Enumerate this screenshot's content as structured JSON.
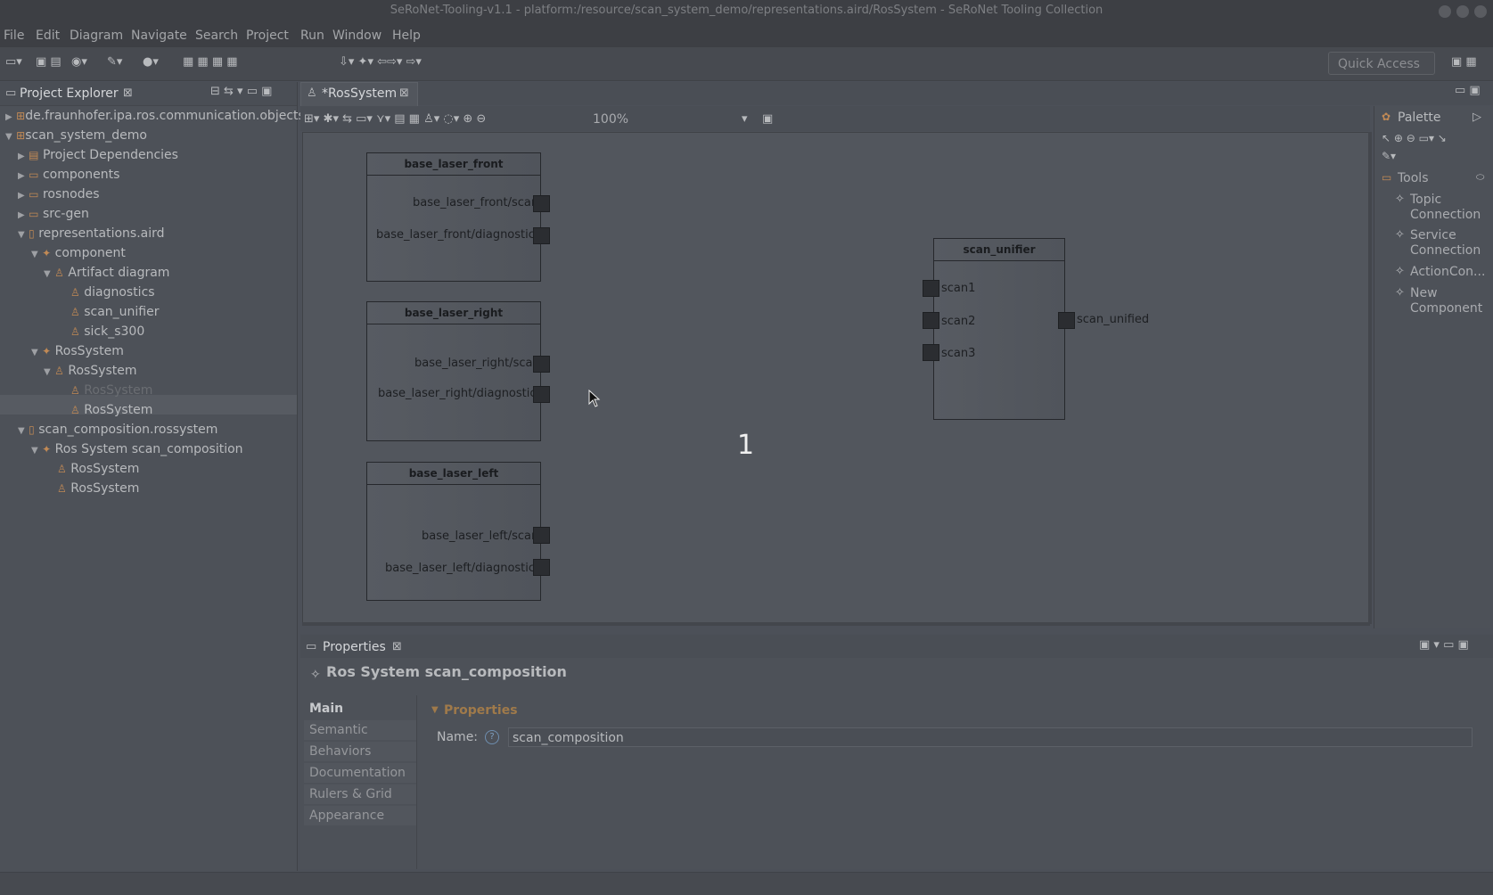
{
  "window": {
    "title": "SeRoNet-Tooling-v1.1 - platform:/resource/scan_system_demo/representations.aird/RosSystem - SeRoNet Tooling Collection"
  },
  "menu": [
    "File",
    "Edit",
    "Diagram",
    "Navigate",
    "Search",
    "Project",
    "Run",
    "Window",
    "Help"
  ],
  "toolbar": {
    "quick_access": "Quick Access"
  },
  "explorer": {
    "title": "Project Explorer",
    "items": [
      "de.fraunhofer.ipa.ros.communication.objects",
      "scan_system_demo",
      "Project Dependencies",
      "components",
      "rosnodes",
      "src-gen",
      "representations.aird",
      "component",
      "Artifact diagram",
      "diagnostics",
      "scan_unifier",
      "sick_s300",
      "RosSystem",
      "RosSystem",
      "RosSystem",
      "RosSystem",
      "scan_composition.rossystem",
      "Ros System scan_composition",
      "RosSystem",
      "RosSystem"
    ]
  },
  "editor": {
    "tab": "*RosSystem",
    "zoom": "100%",
    "step_marker": "1",
    "nodes": [
      {
        "name": "base_laser_front",
        "ports": [
          "base_laser_front/scan",
          "base_laser_front/diagnostics"
        ]
      },
      {
        "name": "base_laser_right",
        "ports": [
          "base_laser_right/scan",
          "base_laser_right/diagnostics"
        ]
      },
      {
        "name": "base_laser_left",
        "ports": [
          "base_laser_left/scan",
          "base_laser_left/diagnostics"
        ]
      },
      {
        "name": "scan_unifier",
        "inputs": [
          "scan1",
          "scan2",
          "scan3"
        ],
        "output": "scan_unified"
      }
    ]
  },
  "palette": {
    "title": "Palette",
    "group": "Tools",
    "items": [
      "Topic Connection",
      "Service Connection",
      "ActionCon...",
      "New Component"
    ]
  },
  "properties": {
    "tab": "Properties",
    "title": "Ros System scan_composition",
    "tabs": [
      "Main",
      "Semantic",
      "Behaviors",
      "Documentation",
      "Rulers & Grid",
      "Appearance"
    ],
    "section": "Properties",
    "name_label": "Name:",
    "name_value": "scan_composition"
  }
}
